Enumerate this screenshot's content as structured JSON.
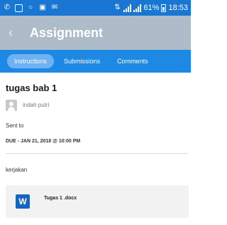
{
  "status_bar": {
    "time": "18:53",
    "battery": "61%",
    "icons": [
      "whatsapp-icon",
      "gallery-icon",
      "circle-icon",
      "chat-icon",
      "mail-icon",
      "data-icon",
      "signal-icon",
      "signal-icon",
      "battery-icon"
    ]
  },
  "app_bar": {
    "title": "Assignment",
    "back_icon": "chevron-left-icon"
  },
  "tabs": [
    {
      "label": "Instructions",
      "active": true
    },
    {
      "label": "Submissions",
      "active": false
    },
    {
      "label": "Comments",
      "active": false
    }
  ],
  "assignment": {
    "title": "tugas bab 1",
    "author": "indah putri",
    "sent_to": "Sent to",
    "due": "DUE - JAN 21, 2018 @ 10:00 PM",
    "description": "kerjakan"
  },
  "attachment": {
    "icon_letter": "W",
    "file_name": "Tugas 1 .docx"
  },
  "colors": {
    "status_bar": "#1976d2",
    "app_bar": "#aebbc9",
    "tab_bar": "#1e88e5",
    "active_tab": "#6fb1f2",
    "word": "#1565c0"
  }
}
